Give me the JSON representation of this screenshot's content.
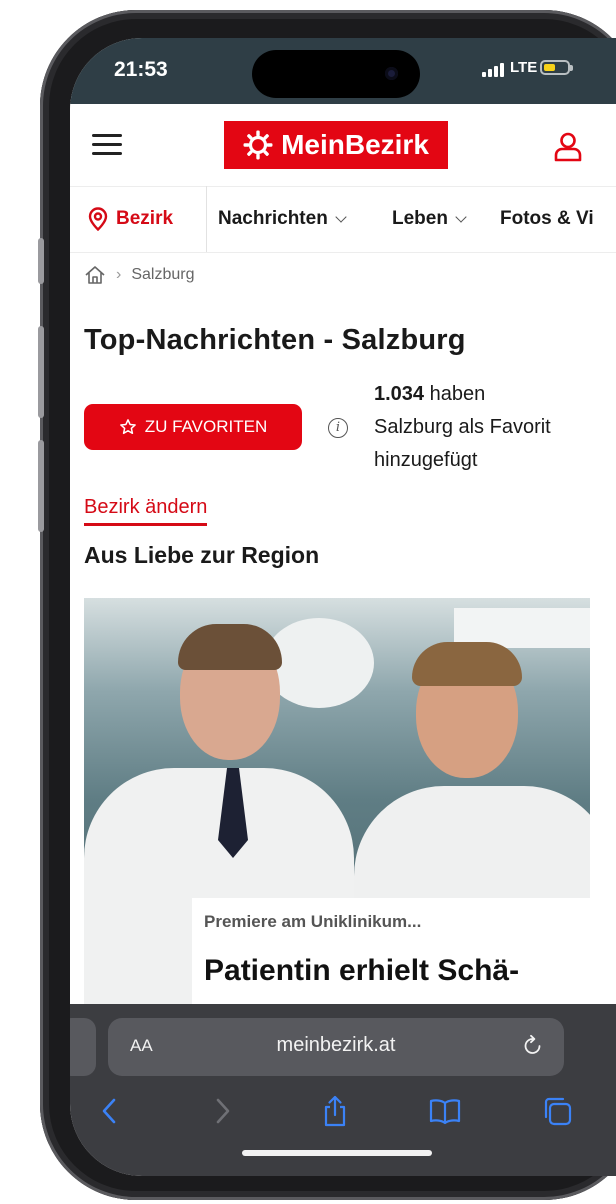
{
  "status_bar": {
    "time": "21:53",
    "network": "LTE"
  },
  "header": {
    "logo_text": "MeinBezirk",
    "brand_color": "#e30613"
  },
  "nav": {
    "bezirk_label": "Bezirk",
    "items": [
      "Nachrichten",
      "Leben",
      "Fotos & Vi"
    ]
  },
  "breadcrumb": {
    "current": "Salzburg"
  },
  "page_title": "Top-Nachrichten - Salzburg",
  "favorite": {
    "button_label": "ZU FAVORITEN",
    "count": "1.034",
    "text_1": " haben",
    "text_2": "Salzburg als Favorit",
    "text_3": "hinzugefügt"
  },
  "change_region_link": "Bezirk ändern",
  "section_title": "Aus Liebe zur Region",
  "article": {
    "kicker": "Premiere am Uniklinikum...",
    "headline": "Patientin erhielt Schä-"
  },
  "browser": {
    "text_size_label": "AA",
    "url": "meinbezirk.at"
  }
}
